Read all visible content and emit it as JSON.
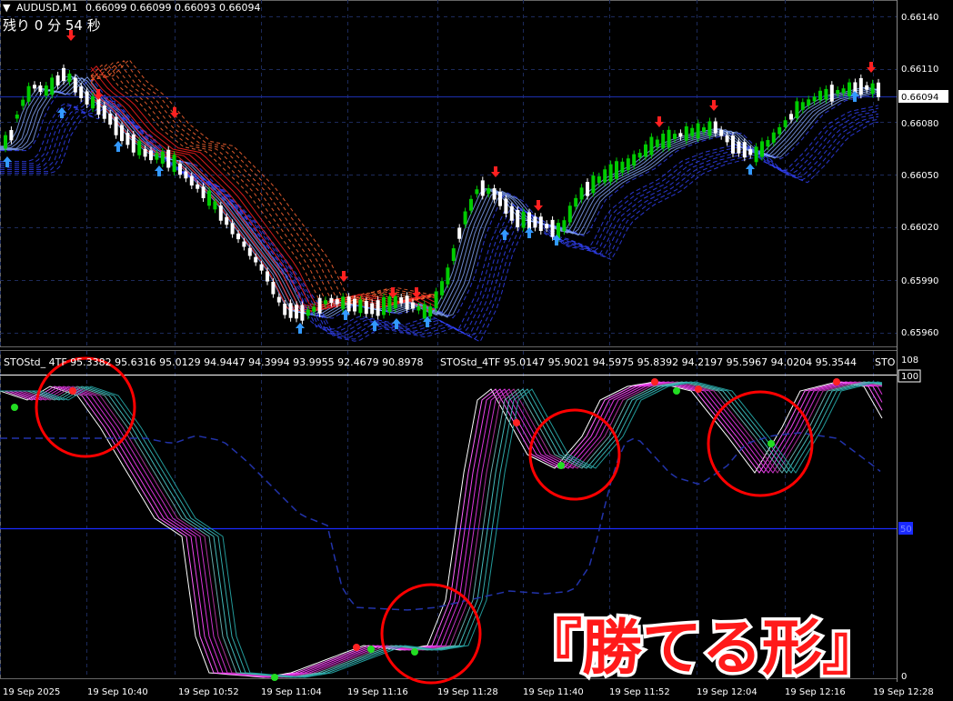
{
  "chart_header": {
    "symbol_label": "AUDUSD,M1",
    "ohlc": "0.66099 0.66099 0.66093 0.66094",
    "timer": "残り 0 分 54 秒"
  },
  "indicator": {
    "legend_1": "STOStd_ 4TF 95.3382 95.6316 95.0129 94.9447 94.3994 93.9955 92.4679 90.8978",
    "legend_2": "STOStd_4TF 95.0147 95.9021 94.5975 95.8392 94.2197 95.5967 94.0204 95.3544",
    "legend_3": "STO"
  },
  "overlay_caption": "『勝てる形』",
  "price_axis": {
    "labels": [
      "0.66140",
      "0.66110",
      "0.66080",
      "0.66050",
      "0.66020",
      "0.65990",
      "0.65960"
    ],
    "current_price": "0.66094"
  },
  "osc_axis": {
    "labels": [
      "108",
      "100",
      "0"
    ],
    "mid_badge": "50"
  },
  "time_axis": {
    "labels": [
      "19 Sep 2025",
      "19 Sep 10:40",
      "19 Sep 10:52",
      "19 Sep 11:04",
      "19 Sep 11:16",
      "19 Sep 11:28",
      "19 Sep 11:40",
      "19 Sep 11:52",
      "19 Sep 12:04",
      "19 Sep 12:16",
      "19 Sep 12:28"
    ]
  },
  "colors": {
    "background": "#000000",
    "bull_candle": "#00cc00",
    "bear_candle": "#ffffff",
    "up_arrow": "#3399ff",
    "down_arrow": "#ff2020",
    "grid": "#1c2a5a",
    "overlay_caption_fill": "#ff1a1a",
    "overlay_caption_stroke": "#ffffff",
    "circle": "#ff0000"
  }
}
